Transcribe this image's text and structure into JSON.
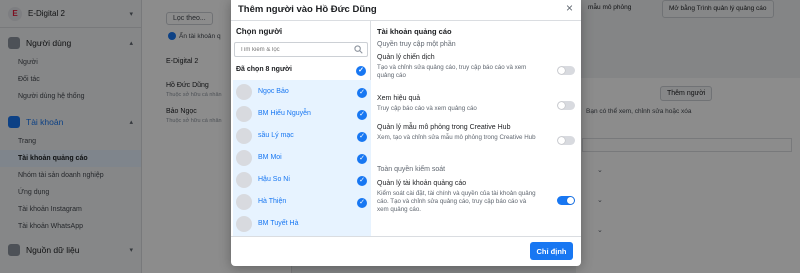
{
  "sidebar": {
    "brand": {
      "logo_letter": "E",
      "name": "E-Digital 2"
    },
    "sections": [
      {
        "label": "Người dùng",
        "items": [
          "Người",
          "Đối tác",
          "Người dùng hệ thống"
        ]
      },
      {
        "label": "Tài khoản",
        "items": [
          "Trang",
          "Tài khoản quảng cáo",
          "Nhóm tài sản doanh nghiệp",
          "Ứng dụng",
          "Tài khoản Instagram",
          "Tài khoản WhatsApp"
        ],
        "active_item": "Tài khoản quảng cáo"
      },
      {
        "label": "Nguồn dữ liệu",
        "items": []
      }
    ]
  },
  "middle": {
    "filter_label": "Lọc theo...",
    "toggle_label": "Ẩn tài khoản q",
    "rows": [
      {
        "name": "E-Digital 2",
        "sub": ""
      },
      {
        "name": "Hồ Đức Dũng",
        "sub": "Thuộc sở hữu cá nhân"
      },
      {
        "name": "Bảo Ngọc",
        "sub": "Thuộc sở hữu cá nhân"
      }
    ]
  },
  "main": {
    "btn_partial": "mẫu mô phỏng",
    "btn_open": "Mở bằng Trình quản lý quảng cáo",
    "add_person": "Thêm người",
    "note": "Bạn có thể xem, chỉnh sửa hoặc xóa"
  },
  "modal": {
    "title": "Thêm người vào Hồ Đức Dũng",
    "close": "×",
    "left": {
      "title": "Chọn người",
      "search_placeholder": "Tìm kiếm & lọc",
      "selected_label": "Đã chọn 8 người",
      "people": [
        "Ngọc Bảo",
        "BM Hiếu Nguyễn",
        "sầu Lý mạc",
        "BM Moi",
        "Hậu So Ni",
        "Hà Thiện",
        "BM Tuyết Hà"
      ]
    },
    "right": {
      "title": "Tài khoản quảng cáo",
      "partial_title": "Quyền truy cập một phần",
      "full_title": "Toàn quyền kiểm soát",
      "permissions": [
        {
          "label": "Quản lý chiến dịch",
          "desc": "Tạo và chỉnh sửa quảng cáo, truy cập báo cáo và xem quảng cáo",
          "enabled": false
        },
        {
          "label": "Xem hiệu quả",
          "desc": "Truy cập báo cáo và xem quảng cáo",
          "enabled": false
        },
        {
          "label": "Quản lý mẫu mô phỏng trong Creative Hub",
          "desc": "Xem, tạo và chỉnh sửa mẫu mô phỏng trong Creative Hub",
          "enabled": false
        },
        {
          "label": "Quản lý tài khoản quảng cáo",
          "desc": "Kiểm soát cài đặt, tài chính và quyền của tài khoản quảng cáo. Tạo và chỉnh sửa quảng cáo, truy cập báo cáo và xem quảng cáo.",
          "enabled": true
        }
      ]
    },
    "confirm_label": "Chỉ định"
  },
  "colors": {
    "accent": "#1877f2",
    "selected_bg": "#e7f3ff",
    "overlay": "rgba(0,0,0,0.45)"
  }
}
